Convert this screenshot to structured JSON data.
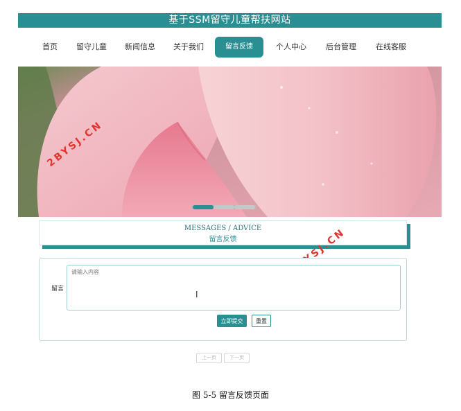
{
  "site_title": "基于SSM留守儿童帮扶网站",
  "nav": {
    "home": "首页",
    "children": "留守儿童",
    "news": "新闻信息",
    "about": "关于我们",
    "feedback": "留言反馈",
    "user_center": "个人中心",
    "admin": "后台管理",
    "support": "在线客服"
  },
  "carousel": {
    "slides_total": 3,
    "active_slide": 1
  },
  "watermark": "2BYSJ.CN",
  "section": {
    "title_en": "MESSAGES / ADVICE",
    "title_cn": "留言反馈"
  },
  "form": {
    "label": "留言",
    "placeholder": "请输入内容",
    "value": "",
    "submit_label": "立即提交",
    "reset_label": "重置"
  },
  "pagination": {
    "prev_label": "上一页",
    "next_label": "下一页"
  },
  "caption": "图 5-5 留言反馈页面",
  "colors": {
    "accent": "#2a8f93",
    "watermark": "#e2342d"
  }
}
